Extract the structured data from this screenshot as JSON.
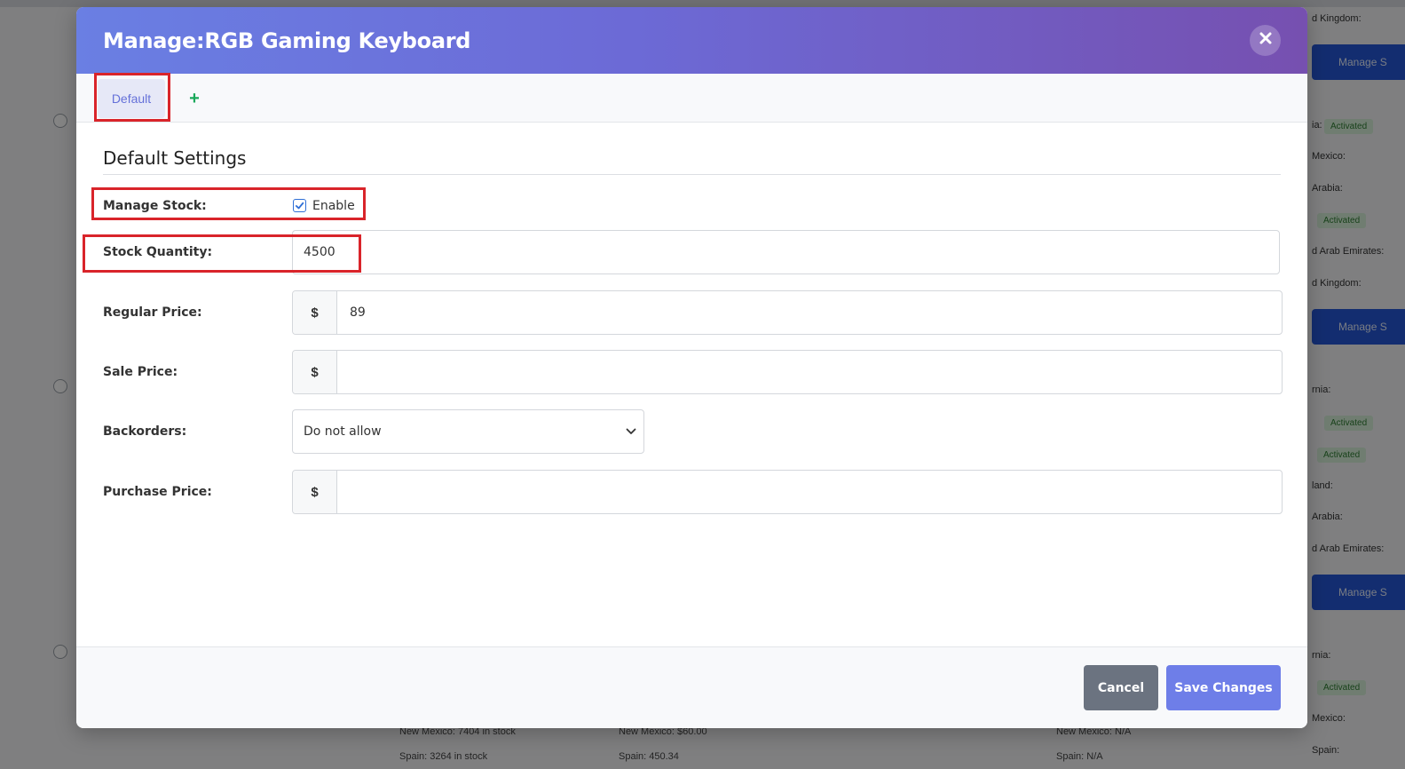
{
  "background": {
    "right_buttons": [
      "Manage S",
      "Manage S",
      "Manage S"
    ],
    "right_labels": [
      "d Kingdom:",
      "ia:",
      "Mexico:",
      "Arabia:",
      "",
      "d Arab Emirates:",
      "d Kingdom:",
      "rnia:",
      "",
      "",
      "land:",
      "Arabia:",
      "d Arab Emirates:",
      "rnia:",
      "",
      "Mexico:",
      "Spain:"
    ],
    "pill_text": "Activated",
    "bottom_texts": [
      "New Mexico:  7404 in stock",
      "New Mexico:  $60.00",
      "New Mexico:  N/A",
      "Spain:  3264 in stock",
      "Spain:  450.34",
      "Spain:  N/A"
    ]
  },
  "modal": {
    "title": "Manage:RGB Gaming Keyboard",
    "close_icon": "close-icon",
    "tabs": {
      "default_label": "Default",
      "add_label": "+"
    },
    "section_title": "Default Settings",
    "fields": {
      "manage_stock": {
        "label": "Manage Stock:",
        "checkbox_label": "Enable",
        "checked": true
      },
      "stock_quantity": {
        "label": "Stock Quantity:",
        "value": "4500"
      },
      "regular_price": {
        "label": "Regular Price:",
        "currency": "$",
        "value": "89"
      },
      "sale_price": {
        "label": "Sale Price:",
        "currency": "$",
        "value": ""
      },
      "backorders": {
        "label": "Backorders:",
        "selected": "Do not allow"
      },
      "purchase_price": {
        "label": "Purchase Price:",
        "currency": "$",
        "value": ""
      }
    },
    "footer": {
      "cancel_label": "Cancel",
      "save_label": "Save Changes"
    }
  },
  "colors": {
    "header_gradient_start": "#6a7fe3",
    "header_gradient_end": "#7650b0",
    "save_button": "#6e7ee8",
    "cancel_button": "#6b7380",
    "highlight_box": "#d9242a",
    "add_tab": "#19a85a"
  }
}
